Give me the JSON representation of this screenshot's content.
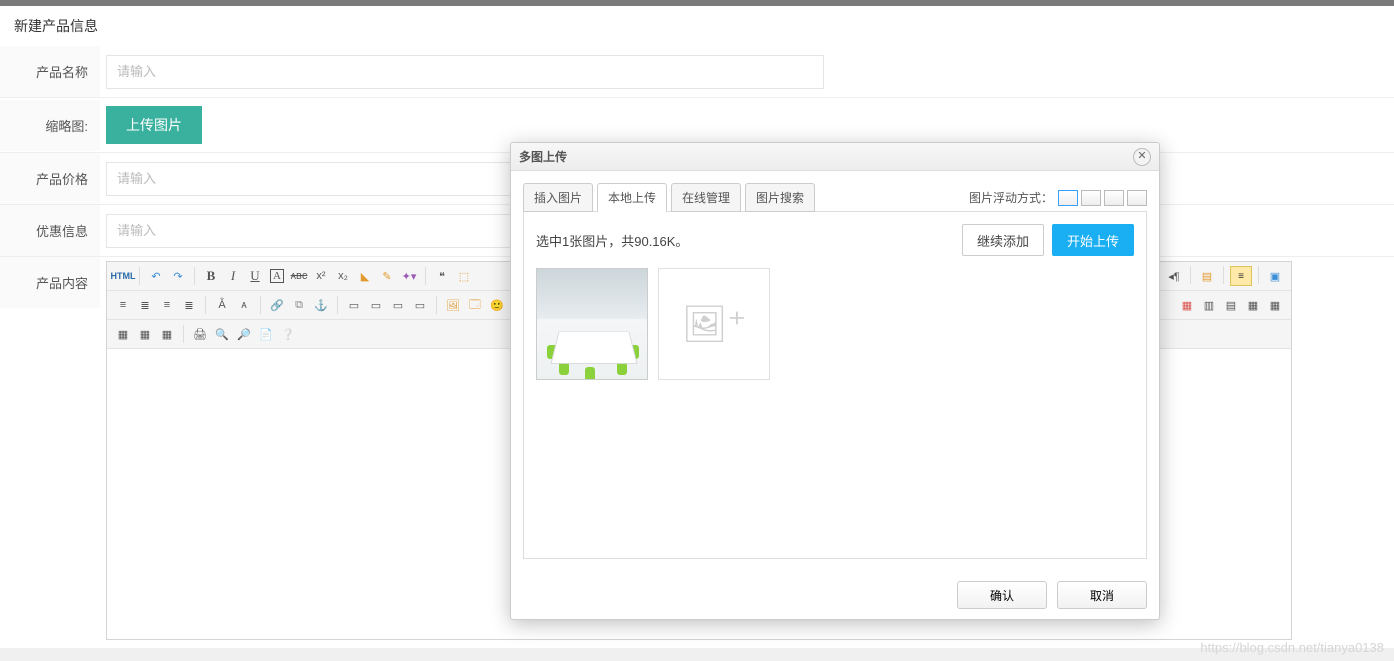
{
  "page": {
    "title": "新建产品信息",
    "labels": {
      "name": "产品名称",
      "thumbnail": "缩略图:",
      "price": "产品价格",
      "promo": "优惠信息",
      "content": "产品内容"
    },
    "placeholder": "请输入",
    "upload_btn": "上传图片"
  },
  "toolbar": {
    "row1": [
      "HTML",
      "|",
      "undo",
      "redo",
      "|",
      "bold",
      "italic",
      "underline",
      "fontborder",
      "strike",
      "sup",
      "sub",
      "eraser",
      "format-brush",
      "paint",
      "|",
      "quote",
      "font-family",
      "|"
    ],
    "row1_right": [
      "dir-l",
      "dir-r",
      "|",
      "indent",
      "|",
      "wrap",
      "|",
      "layout"
    ],
    "row2a": [
      "align-l",
      "align-c",
      "align-r",
      "align-j",
      "|",
      "font-size-up",
      "font-size-down",
      "|",
      "link",
      "unlink",
      "anchor",
      "|",
      "img-l",
      "img-r",
      "img-c",
      "img-n",
      "|",
      "image",
      "emotion",
      "smiley"
    ],
    "row2_right": [
      "t-ins",
      "t-del",
      "t-row",
      "t-prop",
      "t-merge"
    ],
    "row3": [
      "t1",
      "t2",
      "t3",
      "|",
      "print",
      "preview",
      "search",
      "date",
      "help"
    ]
  },
  "dialog": {
    "title": "多图上传",
    "tabs": [
      "插入图片",
      "本地上传",
      "在线管理",
      "图片搜索"
    ],
    "active_tab": 1,
    "float_label": "图片浮动方式：",
    "status": "选中1张图片，共90.16K。",
    "continue_btn": "继续添加",
    "start_btn": "开始上传",
    "ok": "确认",
    "cancel": "取消"
  },
  "watermark": "https://blog.csdn.net/tianya0138"
}
